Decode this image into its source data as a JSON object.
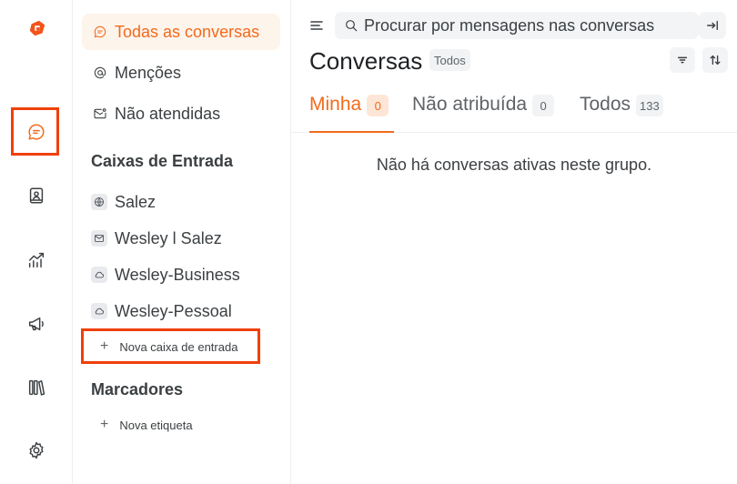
{
  "colors": {
    "accent": "#f26a1b",
    "highlight": "#f0400a",
    "active_bg": "#fdf4ec"
  },
  "rail": {
    "items": [
      {
        "name": "conversations",
        "icon": "chat-bubble-icon",
        "active": true
      },
      {
        "name": "contacts",
        "icon": "contact-book-icon"
      },
      {
        "name": "reports",
        "icon": "chart-trend-icon"
      },
      {
        "name": "campaigns",
        "icon": "megaphone-icon"
      },
      {
        "name": "library",
        "icon": "library-books-icon"
      },
      {
        "name": "settings",
        "icon": "gear-icon"
      }
    ]
  },
  "sidebar": {
    "nav": [
      {
        "label": "Todas as conversas",
        "icon": "chat-bubble-icon",
        "active": true
      },
      {
        "label": "Menções",
        "icon": "at-sign-icon"
      },
      {
        "label": "Não atendidas",
        "icon": "mail-unread-icon"
      }
    ],
    "inboxes_title": "Caixas de Entrada",
    "inboxes": [
      {
        "label": "Salez",
        "icon": "globe-icon"
      },
      {
        "label": "Wesley l Salez",
        "icon": "mail-icon"
      },
      {
        "label": "Wesley-Business",
        "icon": "cloud-icon"
      },
      {
        "label": "Wesley-Pessoal",
        "icon": "cloud-icon"
      }
    ],
    "new_inbox": "Nova caixa de entrada",
    "labels_title": "Marcadores",
    "new_label": "Nova etiqueta"
  },
  "main": {
    "search_placeholder": "Procurar por mensagens nas conversas",
    "title": "Conversas",
    "title_badge": "Todos",
    "tabs": [
      {
        "label": "Minha",
        "count": "0",
        "active": true
      },
      {
        "label": "Não atribuída",
        "count": "0"
      },
      {
        "label": "Todos",
        "count": "133"
      }
    ],
    "empty_message": "Não há conversas ativas neste grupo."
  }
}
